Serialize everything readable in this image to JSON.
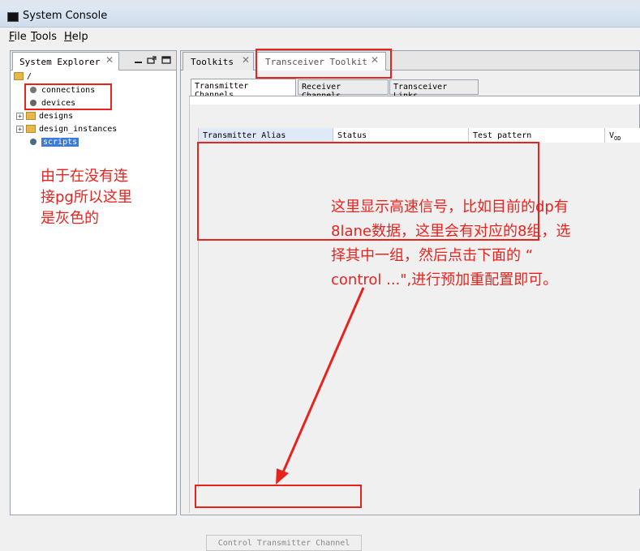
{
  "window": {
    "title": "System Console"
  },
  "menu": [
    "File",
    "Tools",
    "Help"
  ],
  "left_panel": {
    "tab_label": "System Explorer",
    "tree": {
      "root": "/",
      "items": [
        "connections",
        "devices",
        "designs",
        "design_instances",
        "scripts"
      ]
    }
  },
  "right_panel": {
    "tabs": [
      "Toolkits",
      "Transceiver Toolkit"
    ],
    "subtabs": [
      "Transmitter Channels",
      "Receiver Channels",
      "Transceiver Links"
    ],
    "columns": [
      "Transmitter Alias",
      "Status",
      "Test pattern",
      "V",
      "OD"
    ],
    "control_button": "Control Transmitter Channel"
  },
  "annotations": {
    "left_note": "由于在没有连接pg所以这里是灰色的",
    "left_note_lines": [
      "由于在没有连",
      "接pg所以这里",
      "是灰色的"
    ],
    "right_note_lines": [
      "这里显示高速信号，比如目前的dp有",
      "8lane数据，这里会有对应的8组，选",
      "择其中一组，然后点击下面的 “",
      "control ...\",进行预加重配置即可。"
    ]
  },
  "colors": {
    "annotation": "#e8231e",
    "selection": "#3d7bd9"
  }
}
